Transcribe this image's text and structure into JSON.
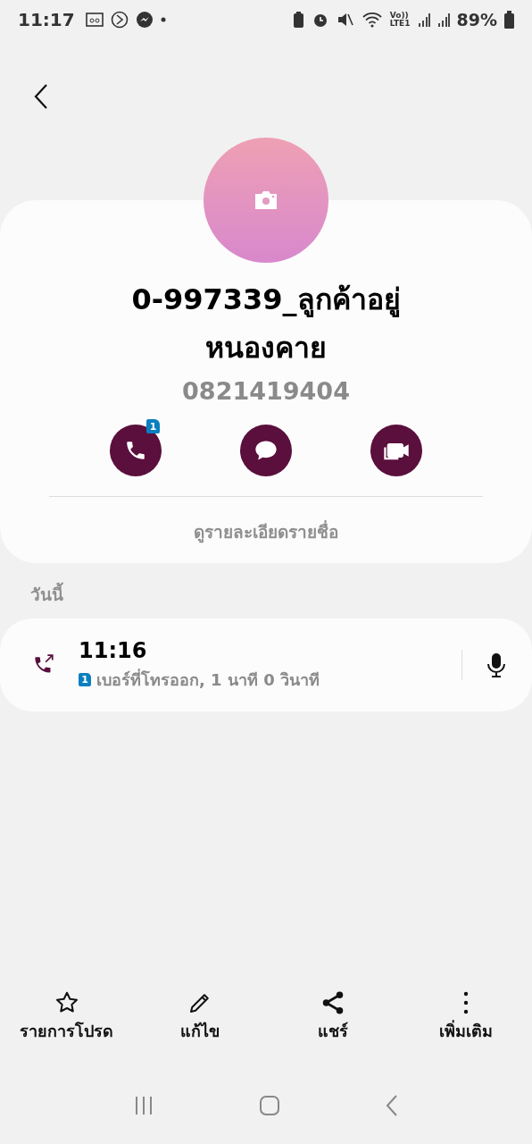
{
  "status_bar": {
    "time": "11:17",
    "volte": "Vo))",
    "network": "LTE1",
    "battery": "89%"
  },
  "contact": {
    "name": "0-997339_ลูกค้าอยู่หนองคาย",
    "phone": "0821419404",
    "actions": [
      {
        "kind": "call",
        "badge": "1"
      },
      {
        "kind": "message"
      },
      {
        "kind": "video"
      }
    ],
    "details_link": "ดูรายละเอียดรายชื่อ"
  },
  "history": {
    "heading": "วันนี้",
    "entries": [
      {
        "time": "11:16",
        "sim": "1",
        "description": "เบอร์ที่โทรออก, 1 นาที 0 วินาที"
      }
    ]
  },
  "bottom_actions": [
    {
      "kind": "favorite",
      "label": "รายการโปรด"
    },
    {
      "kind": "edit",
      "label": "แก้ไข"
    },
    {
      "kind": "share",
      "label": "แชร์"
    },
    {
      "kind": "more",
      "label": "เพิ่มเติม"
    }
  ]
}
